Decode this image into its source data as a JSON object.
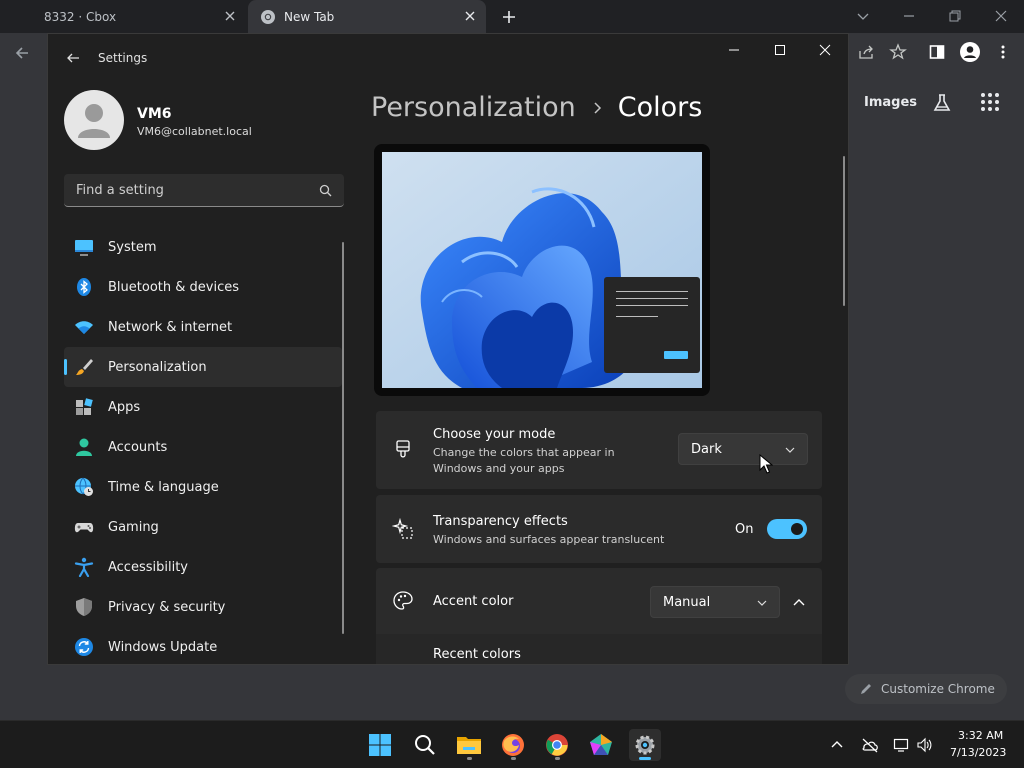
{
  "browser": {
    "tabs": [
      {
        "title": "8332 · Cbox"
      },
      {
        "title": "New Tab"
      }
    ],
    "page": {
      "images_link": "Images",
      "customize_button": "Customize Chrome"
    }
  },
  "settings": {
    "window_title": "Settings",
    "user": {
      "name": "VM6",
      "email": "VM6@collabnet.local"
    },
    "search": {
      "placeholder": "Find a setting"
    },
    "nav": [
      {
        "label": "System",
        "icon": "monitor-icon",
        "active": false
      },
      {
        "label": "Bluetooth & devices",
        "icon": "bluetooth-icon",
        "active": false
      },
      {
        "label": "Network & internet",
        "icon": "wifi-icon",
        "active": false
      },
      {
        "label": "Personalization",
        "icon": "paintbrush-icon",
        "active": true
      },
      {
        "label": "Apps",
        "icon": "apps-icon",
        "active": false
      },
      {
        "label": "Accounts",
        "icon": "person-icon",
        "active": false
      },
      {
        "label": "Time & language",
        "icon": "globe-clock-icon",
        "active": false
      },
      {
        "label": "Gaming",
        "icon": "gamepad-icon",
        "active": false
      },
      {
        "label": "Accessibility",
        "icon": "accessibility-icon",
        "active": false
      },
      {
        "label": "Privacy & security",
        "icon": "shield-icon",
        "active": false
      },
      {
        "label": "Windows Update",
        "icon": "update-icon",
        "active": false
      }
    ],
    "breadcrumb": {
      "parent": "Personalization",
      "current": "Colors"
    },
    "mode": {
      "title": "Choose your mode",
      "description": "Change the colors that appear in Windows and your apps",
      "value": "Dark"
    },
    "transparency": {
      "title": "Transparency effects",
      "description": "Windows and surfaces appear translucent",
      "state_label": "On",
      "enabled": true
    },
    "accent": {
      "title": "Accent color",
      "value": "Manual",
      "recent_colors_label": "Recent colors"
    },
    "accent_color": "#4cc2ff"
  },
  "taskbar": {
    "apps": [
      "start-icon",
      "search-icon",
      "file-explorer-icon",
      "firefox-icon",
      "chrome-icon",
      "pentagon-app-icon",
      "settings-gear-icon"
    ],
    "clock": {
      "time": "3:32 AM",
      "date": "7/13/2023"
    }
  }
}
